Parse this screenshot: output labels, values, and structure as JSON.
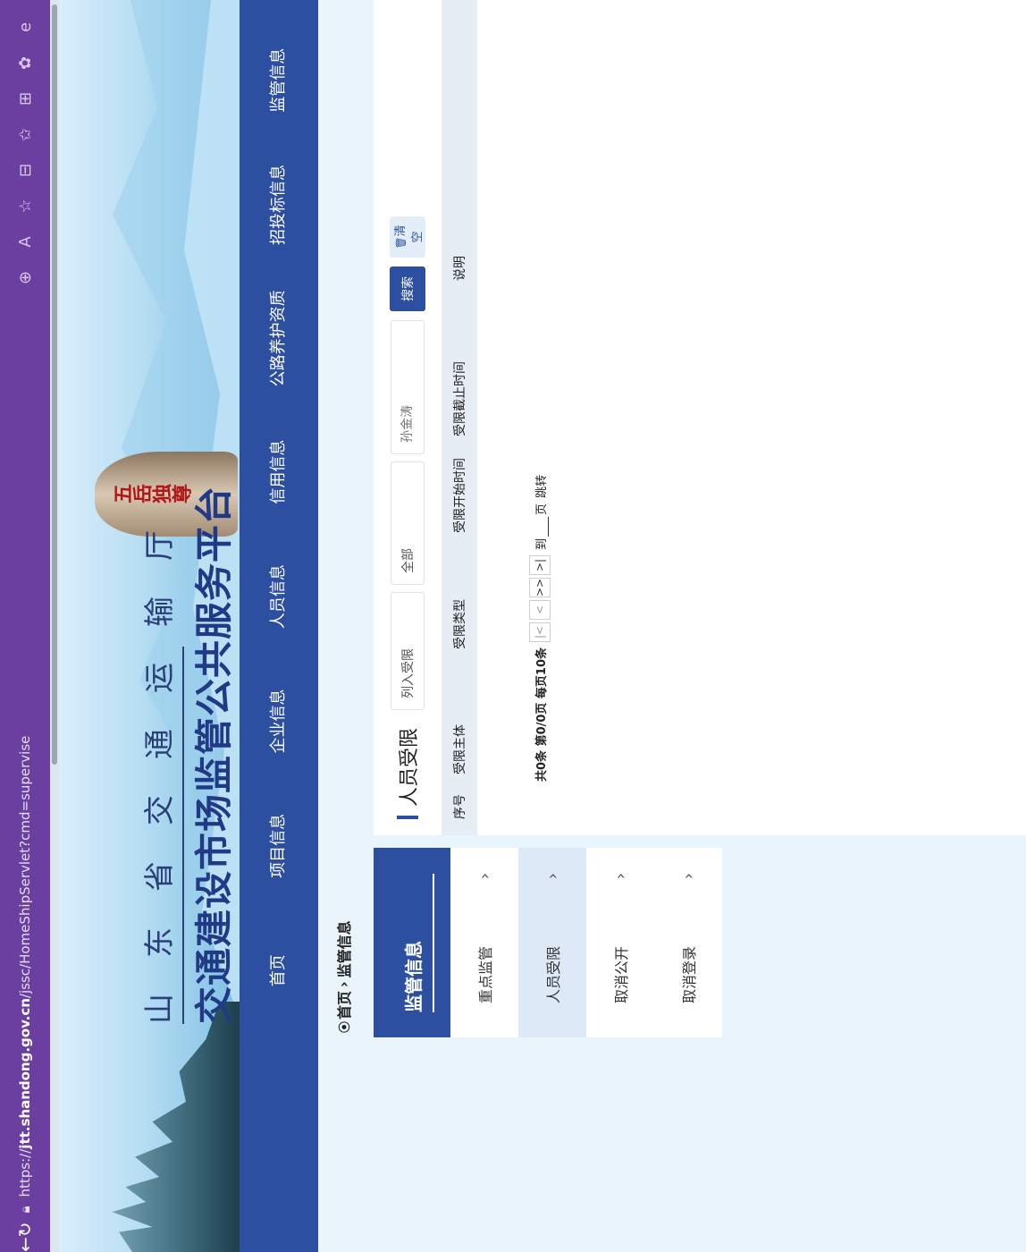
{
  "browser": {
    "url_prefix": "https://",
    "url_host": "jtt.shandong.gov.cn",
    "url_path": "/jssc/HomeShipServlet?cmd=supervise",
    "more_label": "…"
  },
  "banner": {
    "title_small": "山东省交通运输厅",
    "title_big": "交通建设市场监管公共服务平台",
    "rock_text": "五岳独尊"
  },
  "nav": {
    "items": [
      "首页",
      "项目信息",
      "企业信息",
      "人员信息",
      "信用信息",
      "公路养护资质",
      "招投标信息",
      "监管信息"
    ]
  },
  "breadcrumb": {
    "home": "首页",
    "sep": "›",
    "current": "监管信息"
  },
  "sidebar": {
    "header": "监管信息",
    "items": [
      {
        "label": "重点监管",
        "active": false
      },
      {
        "label": "人员受限",
        "active": true
      },
      {
        "label": "取消公开",
        "active": false
      },
      {
        "label": "取消登录",
        "active": false
      }
    ]
  },
  "panel": {
    "title": "人员受限",
    "filter1": "列入受限",
    "filter2": "全部",
    "name_placeholder": "孙金涛",
    "search_label": "搜索",
    "clear_label": "清空",
    "columns": [
      "序号",
      "受限主体",
      "受限类型",
      "受限开始时间",
      "受限截止时间",
      "说明"
    ],
    "pager": {
      "summary": "共0条 第0/0页 每页10条",
      "first": "|<",
      "prev": "<",
      "next": ">>",
      "last": ">|",
      "goto_prefix": "到",
      "goto_suffix": "页",
      "jump": "跳转"
    }
  }
}
